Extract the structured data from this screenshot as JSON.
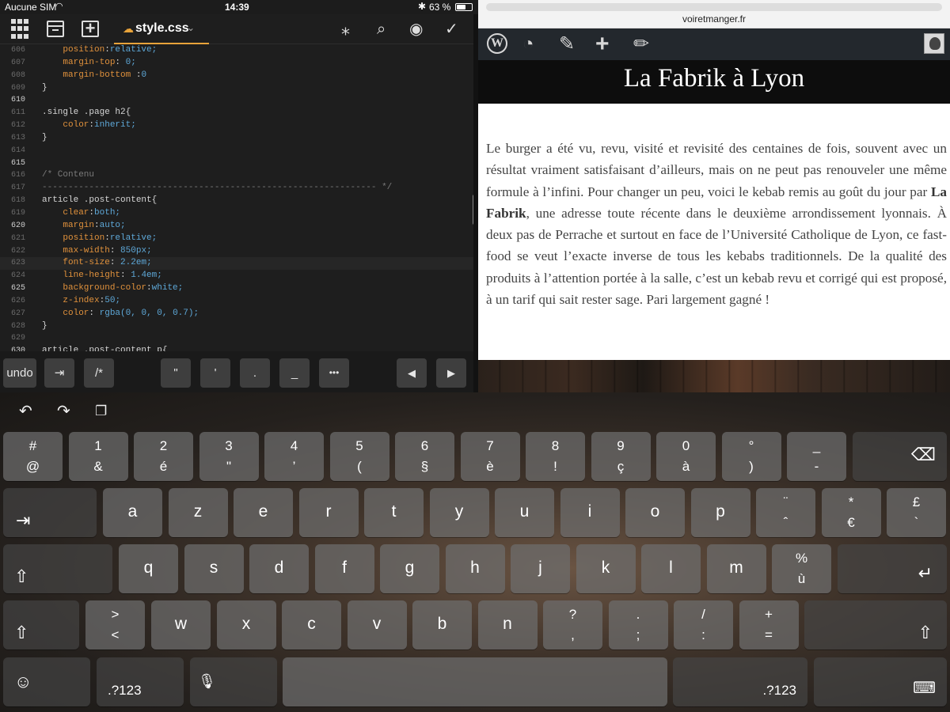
{
  "status": {
    "carrier": "Aucune SIM",
    "time": "14:39",
    "battery": "63 %",
    "battery_level": 0.63,
    "wifi_icon": "wifi-icon",
    "bluetooth_icon": "bluetooth-icon"
  },
  "editor": {
    "tab_name": "style.css",
    "tab_icon": "cloud-icon",
    "toolbar_icons": [
      "grid-icon",
      "browse-icon",
      "new-file-icon",
      "sparkle-icon",
      "search-icon",
      "preview-eye-icon",
      "checkmark-icon"
    ],
    "lines": [
      {
        "n": "606",
        "t": "    position:relative;"
      },
      {
        "n": "607",
        "t": "    margin-top: 0;"
      },
      {
        "n": "608",
        "t": "    margin-bottom :0"
      },
      {
        "n": "609",
        "t": "}"
      },
      {
        "n": "610",
        "t": ""
      },
      {
        "n": "611",
        "t": ".single .page h2{"
      },
      {
        "n": "612",
        "t": "    color:inherit;"
      },
      {
        "n": "613",
        "t": "}"
      },
      {
        "n": "614",
        "t": ""
      },
      {
        "n": "615",
        "t": ""
      },
      {
        "n": "616",
        "t": "/* Contenu"
      },
      {
        "n": "617",
        "t": "---------------------------------------------------------------- */"
      },
      {
        "n": "618",
        "t": "article .post-content{"
      },
      {
        "n": "619",
        "t": "    clear:both;"
      },
      {
        "n": "620",
        "t": "    margin:auto;"
      },
      {
        "n": "621",
        "t": "    position:relative;"
      },
      {
        "n": "622",
        "t": "    max-width: 850px;"
      },
      {
        "n": "623",
        "t": "    font-size: 2.2em;"
      },
      {
        "n": "624",
        "t": "    line-height: 1.4em;"
      },
      {
        "n": "625",
        "t": "    background-color:white;"
      },
      {
        "n": "626",
        "t": "    z-index:50;"
      },
      {
        "n": "627",
        "t": "    color: rgba(0, 0, 0, 0.7);"
      },
      {
        "n": "628",
        "t": "}"
      },
      {
        "n": "629",
        "t": ""
      },
      {
        "n": "630",
        "t": "article .post-content p{"
      }
    ],
    "accessory": {
      "undo": "undo",
      "indent": "⇥",
      "comment": "/*",
      "dquote": "\"",
      "squote": "'",
      "dot": ".",
      "underscore": "_",
      "more": "•••",
      "left": "◀",
      "right": "▶"
    },
    "colors": {
      "property": "#e0913c",
      "value": "#5ea8d8",
      "comment": "#7a7a7a",
      "tab_accent": "#e8a33a"
    }
  },
  "browser": {
    "url": "voiretmanger.fr",
    "wp_icons": [
      "wordpress-icon",
      "customize-palette-icon",
      "brush-icon",
      "add-new-icon",
      "edit-pencil-icon",
      "user-avatar"
    ],
    "site_title": "La Fabrik à Lyon",
    "article_before": "Le burger a été vu, revu, visité et revisité des centaines de fois, souvent avec un résultat vraiment satisfaisant d’ailleurs, mais on ne peut pas renouveler une même formule à l’infini. Pour changer un peu, voici le kebab remis au goût du jour par ",
    "article_bold": "La Fabrik",
    "article_after": ", une adresse toute récente dans le deuxième arrondissement lyonnais. À deux pas de Perrache et surtout en face de l’Université Catholique de Lyon, ce fast-food se veut l’exacte inverse de tous les kebabs traditionnels. De la qualité des produits à l’attention portée à la salle, c’est un kebab revu et corrigé qui est proposé, à un tarif qui sait rester sage. Pari largement gagné !"
  },
  "keyboard": {
    "tools": [
      "undo-arrow-icon",
      "redo-arrow-icon",
      "paste-icon"
    ],
    "row1": [
      {
        "up": "#",
        "dn": "@"
      },
      {
        "up": "1",
        "dn": "&"
      },
      {
        "up": "2",
        "dn": "é"
      },
      {
        "up": "3",
        "dn": "\""
      },
      {
        "up": "4",
        "dn": "’"
      },
      {
        "up": "5",
        "dn": "("
      },
      {
        "up": "6",
        "dn": "§"
      },
      {
        "up": "7",
        "dn": "è"
      },
      {
        "up": "8",
        "dn": "!"
      },
      {
        "up": "9",
        "dn": "ç"
      },
      {
        "up": "0",
        "dn": "à"
      },
      {
        "up": "°",
        "dn": ")"
      },
      {
        "up": "_",
        "dn": "-"
      }
    ],
    "row2": [
      "a",
      "z",
      "e",
      "r",
      "t",
      "y",
      "u",
      "i",
      "o",
      "p"
    ],
    "row2_extra": [
      {
        "up": "¨",
        "dn": "ˆ"
      },
      {
        "up": "*",
        "dn": "€"
      },
      {
        "up": "£",
        "dn": "`"
      }
    ],
    "row3": [
      "q",
      "s",
      "d",
      "f",
      "g",
      "h",
      "j",
      "k",
      "l",
      "m"
    ],
    "row3_extra": {
      "up": "%",
      "dn": "ù"
    },
    "row4_first": {
      "up": ">",
      "dn": "<"
    },
    "row4": [
      "w",
      "x",
      "c",
      "v",
      "b",
      "n"
    ],
    "row4_extra": [
      {
        "up": "?",
        "dn": ","
      },
      {
        "up": ".",
        "dn": ";"
      },
      {
        "up": "/",
        "dn": ":"
      },
      {
        "up": "+",
        "dn": "="
      }
    ],
    "numbers_label": ".?123",
    "emoji_icon": "emoji-icon",
    "mic_icon": "microphone-icon",
    "hide_icon": "hide-keyboard-icon"
  }
}
